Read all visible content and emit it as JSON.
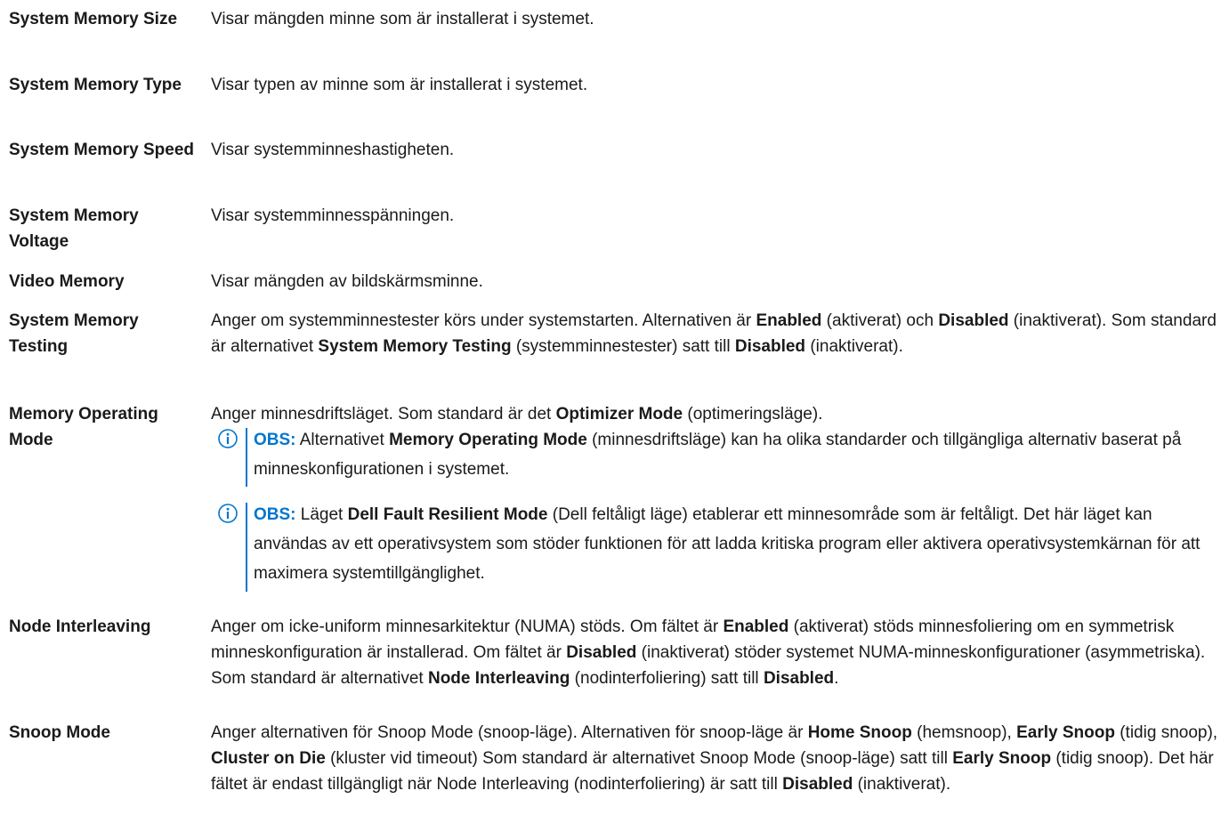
{
  "colors": {
    "accent": "#0076ce",
    "text": "#1a1a1a"
  },
  "rows": [
    {
      "term": "System Memory Size",
      "desc": "Visar mängden minne som är installerat i systemet."
    },
    {
      "term": "System Memory Type",
      "desc": "Visar typen av minne som är installerat i systemet."
    },
    {
      "term": "System Memory Speed",
      "desc": "Visar systemminneshastigheten."
    },
    {
      "term": "System Memory Voltage",
      "desc": "Visar systemminnesspänningen."
    },
    {
      "term": "Video Memory",
      "desc": "Visar mängden av bildskärmsminne."
    },
    {
      "term": "System Memory Testing",
      "desc": [
        "Anger om systemminnestester körs under systemstarten. Alternativen är ",
        "Enabled",
        " (aktiverat) och ",
        "Disabled",
        " (inaktiverat). Som standard är alternativet ",
        "System Memory Testing",
        " (systemminnestester) satt till ",
        "Disabled",
        " (inaktiverat)."
      ]
    },
    {
      "term": "Memory Operating Mode",
      "desc": [
        "Anger minnesdriftsläget. Som standard är det ",
        "Optimizer Mode",
        " (optimeringsläge)."
      ],
      "notes": [
        {
          "icon": "info-icon",
          "label": "OBS:",
          "text": [
            " Alternativet ",
            "Memory Operating Mode",
            " (minnesdriftsläge) kan ha olika standarder och tillgängliga alternativ baserat på minneskonfigurationen i systemet."
          ]
        },
        {
          "icon": "info-icon",
          "label": "OBS:",
          "text": [
            " Läget ",
            "Dell Fault Resilient Mode",
            " (Dell feltåligt läge) etablerar ett minnesområde som är feltåligt. Det här läget kan användas av ett operativsystem som stöder funktionen för att ladda kritiska program eller aktivera operativsystemkärnan för att maximera systemtillgänglighet."
          ]
        }
      ]
    },
    {
      "term": "Node Interleaving",
      "desc": [
        "Anger om icke-uniform minnesarkitektur (NUMA) stöds. Om fältet är ",
        "Enabled",
        " (aktiverat) stöds minnesfoliering om en symmetrisk minneskonfiguration är installerad. Om fältet är ",
        "Disabled",
        " (inaktiverat) stöder systemet NUMA-minneskonfigurationer (asymmetriska). Som standard är alternativet ",
        "Node Interleaving",
        " (nodinterfoliering) satt till ",
        "Disabled",
        "."
      ]
    },
    {
      "term": "Snoop Mode",
      "desc": [
        "Anger alternativen för Snoop Mode (snoop-läge). Alternativen för snoop-läge är ",
        "Home Snoop",
        " (hemsnoop), ",
        "Early Snoop",
        " (tidig snoop), ",
        "Cluster on Die",
        " (kluster vid timeout) Som standard är alternativet Snoop Mode (snoop-läge) satt till ",
        "Early Snoop",
        " (tidig snoop). Det här fältet är endast tillgängligt när Node Interleaving (nodinterfoliering) är satt till ",
        "Disabled",
        " (inaktiverat)."
      ]
    }
  ]
}
